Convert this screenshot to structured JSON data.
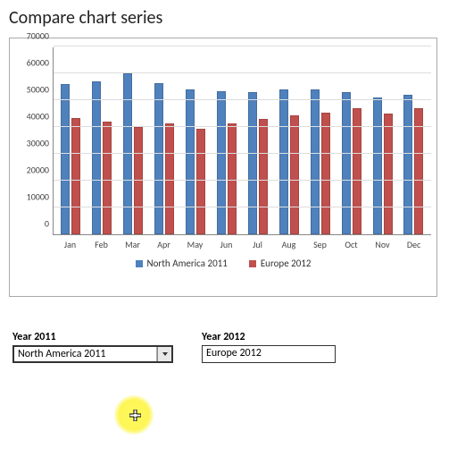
{
  "title": "Compare chart series",
  "chart_data": {
    "type": "bar",
    "categories": [
      "Jan",
      "Feb",
      "Mar",
      "Apr",
      "May",
      "Jun",
      "Jul",
      "Aug",
      "Sep",
      "Oct",
      "Nov",
      "Dec"
    ],
    "series": [
      {
        "name": "North America 2011",
        "color": "#4f81bd",
        "values": [
          56000,
          57000,
          60000,
          56500,
          54000,
          53500,
          53000,
          54000,
          54000,
          53000,
          51000,
          52000
        ]
      },
      {
        "name": "Europe 2012",
        "color": "#c0504d",
        "values": [
          43500,
          42000,
          40000,
          41500,
          39500,
          41500,
          43000,
          44500,
          45500,
          47000,
          45000,
          47000
        ]
      }
    ],
    "ylabel": "",
    "xlabel": "",
    "ylim": [
      0,
      70000
    ],
    "yticks": [
      0,
      10000,
      20000,
      30000,
      40000,
      50000,
      60000,
      70000
    ]
  },
  "legend": {
    "items": [
      {
        "label": "North America 2011"
      },
      {
        "label": "Europe 2012"
      }
    ]
  },
  "controls": {
    "left": {
      "label": "Year 2011",
      "value": "North America 2011"
    },
    "right": {
      "label": "Year 2012",
      "value": "Europe 2012"
    }
  }
}
